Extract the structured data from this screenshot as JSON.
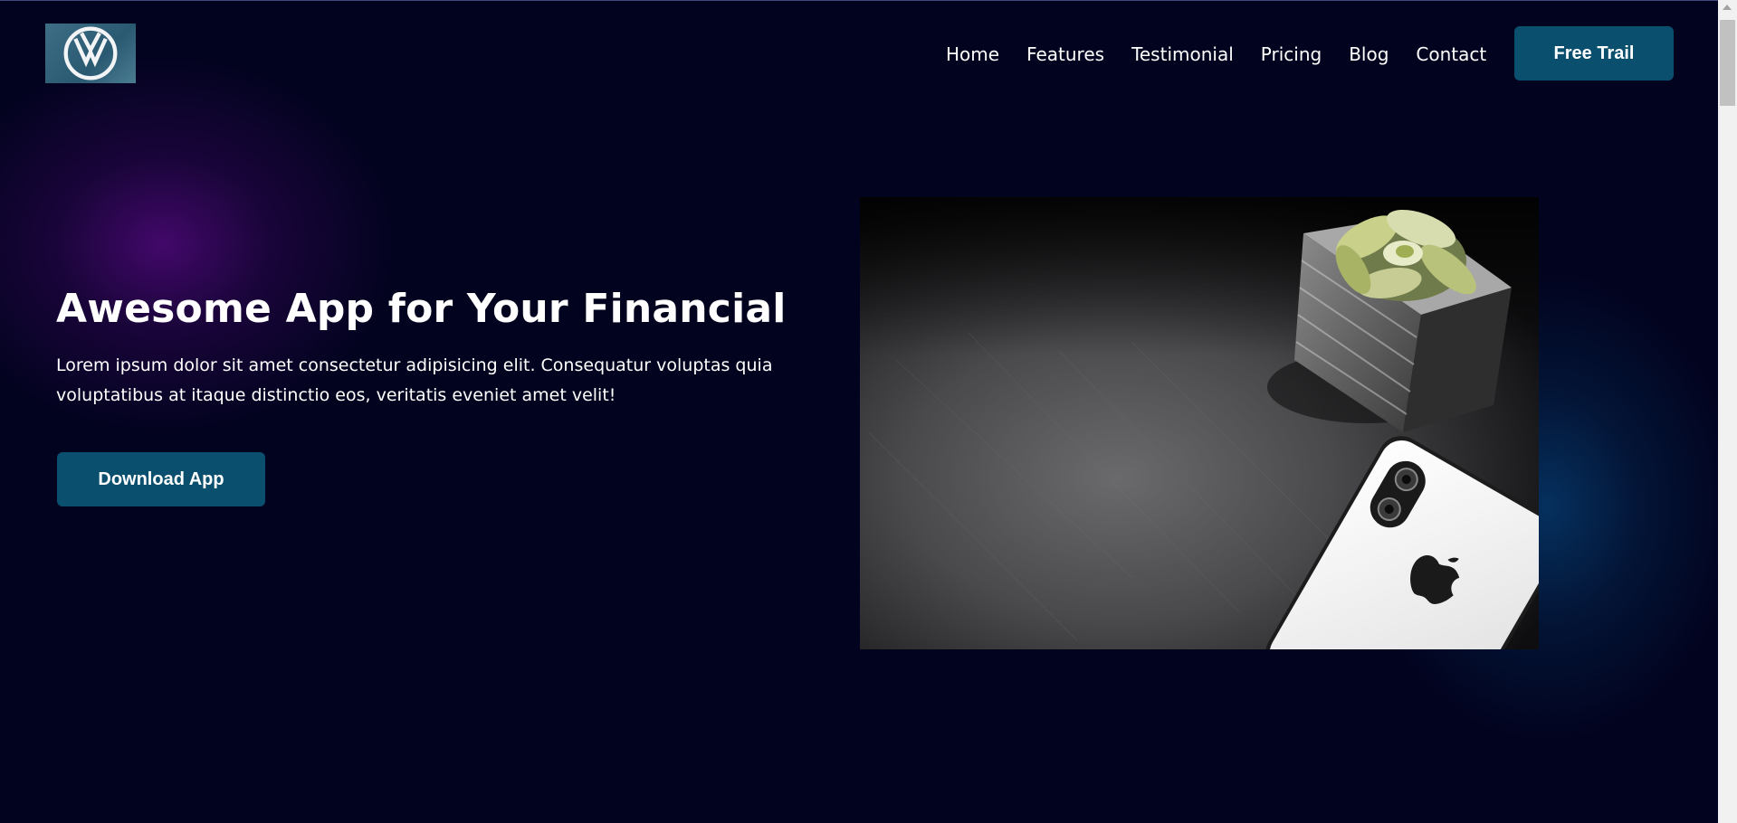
{
  "logo": {
    "icon": "vw-logo-icon"
  },
  "nav": {
    "items": [
      {
        "label": "Home"
      },
      {
        "label": "Features"
      },
      {
        "label": "Testimonial"
      },
      {
        "label": "Pricing"
      },
      {
        "label": "Blog"
      },
      {
        "label": "Contact"
      }
    ],
    "cta_label": "Free Trail"
  },
  "hero": {
    "title": "Awesome App for Your Financial",
    "text": "Lorem ipsum dolor sit amet consectetur adipisicing elit. Consequatur voluptas quia voluptatibus at itaque distinctio eos, veritatis eveniet amet velit!",
    "button_label": "Download App",
    "image_icon": "desk-plant-phone-photo"
  },
  "colors": {
    "background": "#02031f",
    "button": "#0a4f6e",
    "text": "#ffffff",
    "glow_purple": "#46086e",
    "glow_blue": "#063c6e"
  }
}
